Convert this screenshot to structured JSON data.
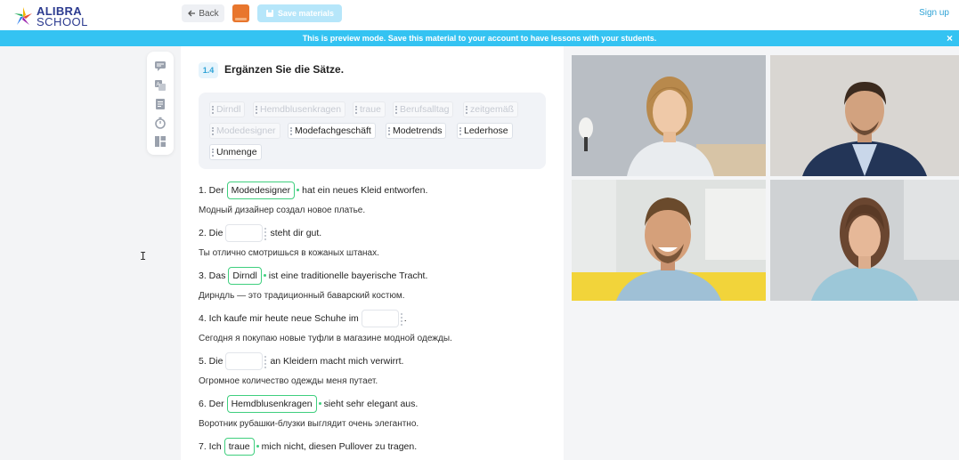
{
  "brand": {
    "line1": "ALIBRA",
    "line2": "SCHOOL"
  },
  "header": {
    "back_label": "Back",
    "save_label": "Save materials",
    "signup_label": "Sign up"
  },
  "banner": {
    "text": "This is preview mode. Save this material to your account to have lessons with your students.",
    "close_glyph": "×"
  },
  "exercise": {
    "number": "1.4",
    "title": "Ergänzen Sie die Sätze."
  },
  "wordbank": [
    {
      "label": "Dirndl",
      "used": true
    },
    {
      "label": "Hemdblusenkragen",
      "used": true
    },
    {
      "label": "traue",
      "used": true
    },
    {
      "label": "Berufsalltag",
      "used": true
    },
    {
      "label": "zeitgemäß",
      "used": true
    },
    {
      "label": "Modedesigner",
      "used": true
    },
    {
      "label": "Modefachgeschäft",
      "used": false
    },
    {
      "label": "Modetrends",
      "used": false
    },
    {
      "label": "Lederhose",
      "used": false
    },
    {
      "label": "Unmenge",
      "used": false
    }
  ],
  "sentences": [
    {
      "pre": "1. Der",
      "answer": "Modedesigner",
      "post": "hat ein neues Kleid entworfen.",
      "ru": "Модный дизайнер создал новое платье."
    },
    {
      "pre": "2. Die",
      "answer": "",
      "post": "steht dir gut.",
      "ru": "Ты отлично смотришься в кожаных штанах."
    },
    {
      "pre": "3. Das",
      "answer": "Dirndl",
      "post": "ist eine traditionelle bayerische Tracht.",
      "ru": "Дирндль — это традиционный баварский костюм."
    },
    {
      "pre": "4. Ich kaufe mir heute neue Schuhe im",
      "answer": "",
      "post": ".",
      "ru": "Сегодня я покупаю новые туфли в магазине модной одежды."
    },
    {
      "pre": "5. Die",
      "answer": "",
      "post": "an Kleidern macht mich verwirrt.",
      "ru": "Огромное количество одежды меня путает."
    },
    {
      "pre": "6. Der",
      "answer": "Hemdblusenkragen",
      "post": "sieht sehr elegant aus.",
      "ru": "Воротник рубашки-блузки выглядит очень элегантно."
    },
    {
      "pre": "7. Ich",
      "answer": "traue",
      "post": "mich nicht, diesen Pullover zu tragen.",
      "ru": ""
    }
  ],
  "toolbar_icons": [
    "chat-icon",
    "translate-icon",
    "notes-icon",
    "timer-icon",
    "layout-icon"
  ],
  "colors": {
    "accent": "#34c3f2",
    "answer_border": "#3fcf7e",
    "brand": "#2b3a8f"
  }
}
